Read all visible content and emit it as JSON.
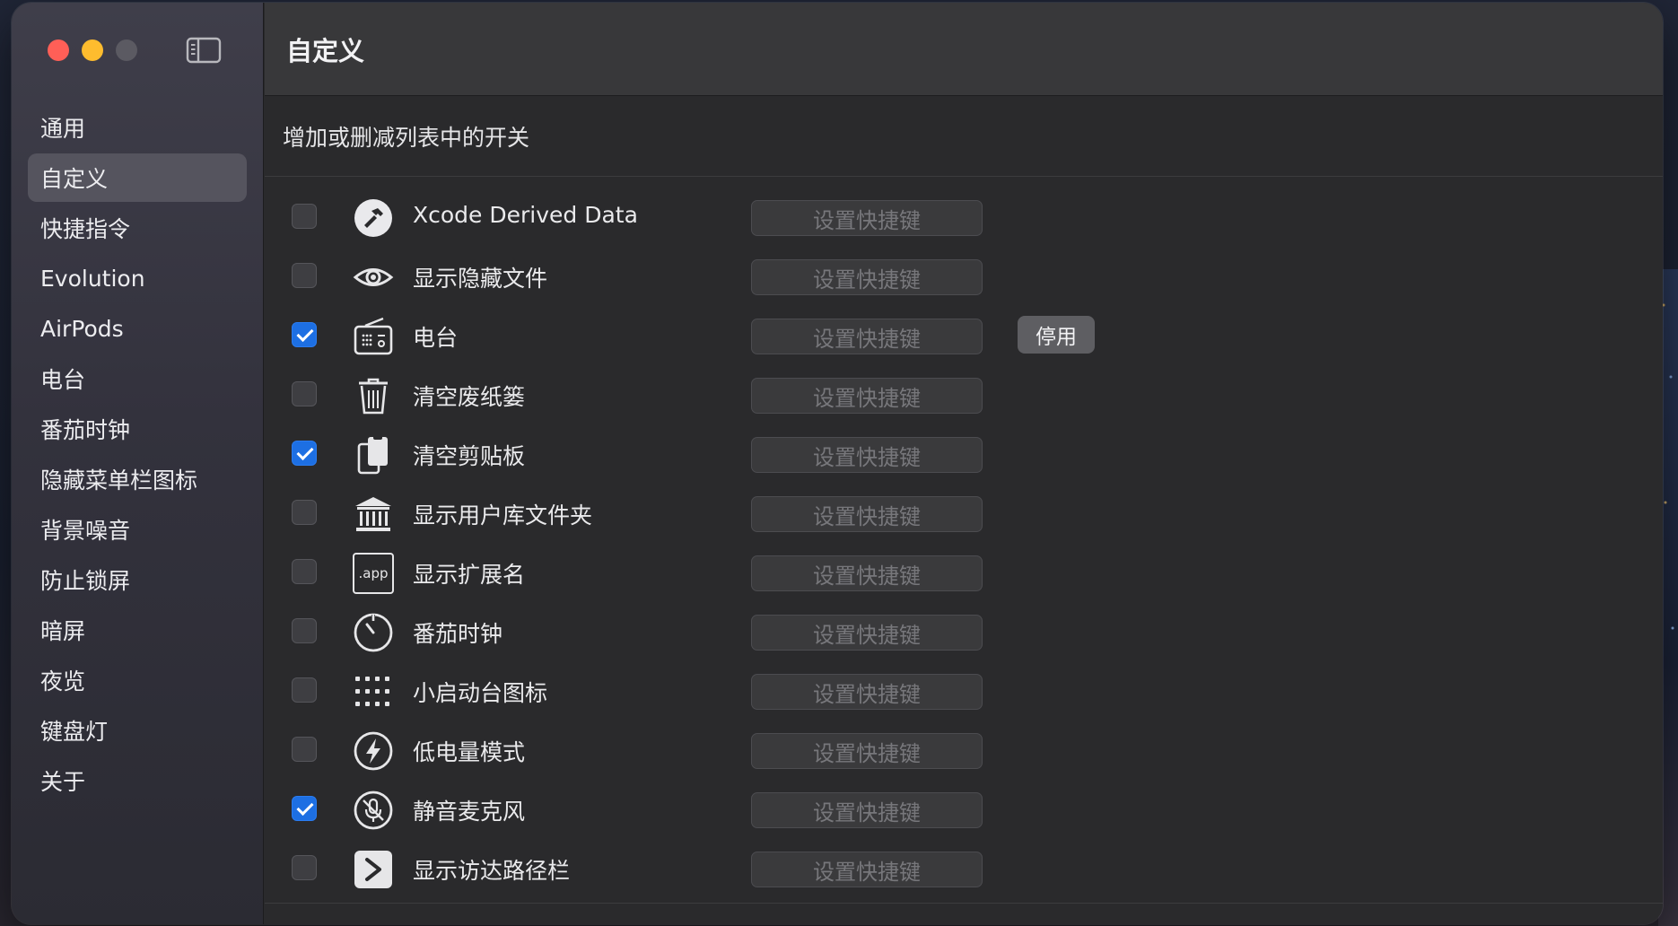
{
  "window": {
    "title": "自定义",
    "subtitle": "增加或删减列表中的开关"
  },
  "sidebar": {
    "items": [
      {
        "label": "通用",
        "selected": false
      },
      {
        "label": "自定义",
        "selected": true
      },
      {
        "label": "快捷指令",
        "selected": false
      },
      {
        "label": "Evolution",
        "selected": false
      },
      {
        "label": "AirPods",
        "selected": false
      },
      {
        "label": "电台",
        "selected": false
      },
      {
        "label": "番茄时钟",
        "selected": false
      },
      {
        "label": "隐藏菜单栏图标",
        "selected": false
      },
      {
        "label": "背景噪音",
        "selected": false
      },
      {
        "label": "防止锁屏",
        "selected": false
      },
      {
        "label": "暗屏",
        "selected": false
      },
      {
        "label": "夜览",
        "selected": false
      },
      {
        "label": "键盘灯",
        "selected": false
      },
      {
        "label": "关于",
        "selected": false
      }
    ]
  },
  "shortcut_label": "设置快捷键",
  "disable_label": "停用",
  "toggles": [
    {
      "label": "Xcode Derived Data",
      "checked": false,
      "icon": "hammer-icon"
    },
    {
      "label": "显示隐藏文件",
      "checked": false,
      "icon": "eye-icon"
    },
    {
      "label": "电台",
      "checked": true,
      "icon": "radio-icon",
      "has_disable": true
    },
    {
      "label": "清空废纸篓",
      "checked": false,
      "icon": "trash-icon"
    },
    {
      "label": "清空剪贴板",
      "checked": true,
      "icon": "clipboard-icon"
    },
    {
      "label": "显示用户库文件夹",
      "checked": false,
      "icon": "library-icon"
    },
    {
      "label": "显示扩展名",
      "checked": false,
      "icon": "app-extension-icon",
      "icon_text": ".app"
    },
    {
      "label": "番茄时钟",
      "checked": false,
      "icon": "timer-icon"
    },
    {
      "label": "小启动台图标",
      "checked": false,
      "icon": "grid-icon"
    },
    {
      "label": "低电量模式",
      "checked": false,
      "icon": "bolt-icon"
    },
    {
      "label": "静音麦克风",
      "checked": true,
      "icon": "mic-mute-icon"
    },
    {
      "label": "显示访达路径栏",
      "checked": false,
      "icon": "chevron-right-icon"
    }
  ],
  "colors": {
    "accent": "#1d6fe3",
    "close": "#ff5f57",
    "minimize": "#febc2e"
  }
}
